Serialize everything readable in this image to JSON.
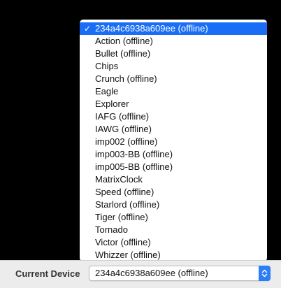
{
  "dropdown": {
    "items": [
      {
        "label": "234a4c6938a609ee (offline)",
        "selected": true
      },
      {
        "label": "Action (offline)",
        "selected": false
      },
      {
        "label": "Bullet (offline)",
        "selected": false
      },
      {
        "label": "Chips",
        "selected": false
      },
      {
        "label": "Crunch (offline)",
        "selected": false
      },
      {
        "label": "Eagle",
        "selected": false
      },
      {
        "label": "Explorer",
        "selected": false
      },
      {
        "label": "IAFG (offline)",
        "selected": false
      },
      {
        "label": "IAWG (offline)",
        "selected": false
      },
      {
        "label": "imp002 (offline)",
        "selected": false
      },
      {
        "label": "imp003-BB (offline)",
        "selected": false
      },
      {
        "label": "imp005-BB (offline)",
        "selected": false
      },
      {
        "label": "MatrixClock",
        "selected": false
      },
      {
        "label": "Speed (offline)",
        "selected": false
      },
      {
        "label": "Starlord (offline)",
        "selected": false
      },
      {
        "label": "Tiger (offline)",
        "selected": false
      },
      {
        "label": "Tornado",
        "selected": false
      },
      {
        "label": "Victor (offline)",
        "selected": false
      },
      {
        "label": "Whizzer (offline)",
        "selected": false
      }
    ],
    "check_glyph": "✓"
  },
  "footer": {
    "label": "Current Device",
    "selected_value": "234a4c6938a609ee (offline)",
    "arrow_icon": "chevron-up-down-icon"
  },
  "colors": {
    "highlight": "#1a6ef5",
    "background": "#000000",
    "footer_bg": "#ececec",
    "arrow_bg": "#2c7ef7"
  }
}
